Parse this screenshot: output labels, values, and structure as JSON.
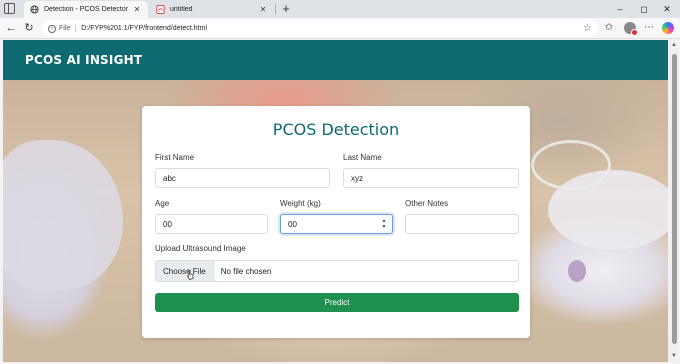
{
  "browser": {
    "tabs": [
      {
        "label": "Detection - PCOS Detector",
        "active": true,
        "icon": "globe-icon"
      },
      {
        "label": "untitled",
        "active": false,
        "icon": "pdf-icon"
      }
    ],
    "new_tab_symbol": "+",
    "window_controls": {
      "minimize": "–",
      "maximize": "◻",
      "close": "✕"
    },
    "address": {
      "scheme_chip": "File",
      "url": "D:/FYP%201.1/FYP/frontend/detect.html"
    },
    "accent_color": "#0d6a71"
  },
  "page": {
    "brand": "PCOS AI INSIGHT",
    "card_title": "PCOS Detection",
    "form": {
      "first_name": {
        "label": "First Name",
        "value": "abc"
      },
      "last_name": {
        "label": "Last Name",
        "value": "xyz"
      },
      "age": {
        "label": "Age",
        "value": "00"
      },
      "weight": {
        "label": "Weight (kg)",
        "value": "00"
      },
      "other_notes": {
        "label": "Other Notes",
        "value": ""
      },
      "upload": {
        "label": "Upload Ultrasound Image",
        "button": "Choose File",
        "status": "No file chosen"
      },
      "submit_label": "Predict"
    },
    "colors": {
      "header": "#0d6a71",
      "title": "#0d6a71",
      "submit": "#1f8f4e"
    }
  }
}
